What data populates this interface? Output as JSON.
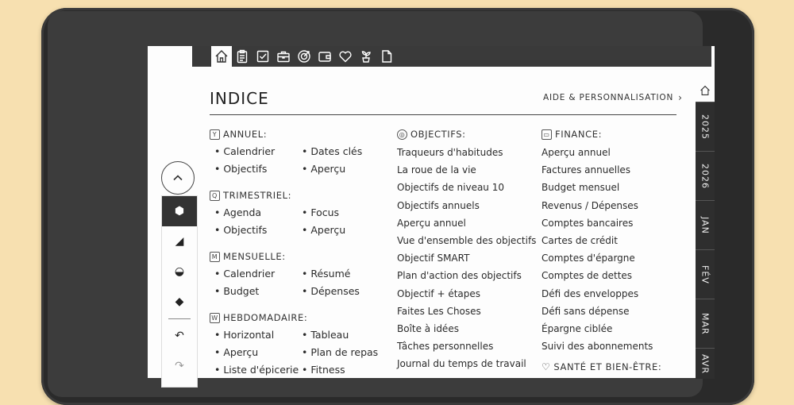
{
  "top_tabs": [
    {
      "icon": "home-icon",
      "active": true
    },
    {
      "icon": "clipboard-icon",
      "active": false
    },
    {
      "icon": "checkbox-icon",
      "active": false
    },
    {
      "icon": "briefcase-icon",
      "active": false
    },
    {
      "icon": "target-icon",
      "active": false
    },
    {
      "icon": "wallet-icon",
      "active": false
    },
    {
      "icon": "heart-icon",
      "active": false
    },
    {
      "icon": "plant-icon",
      "active": false
    },
    {
      "icon": "document-icon",
      "active": false
    }
  ],
  "page": {
    "title": "INDICE",
    "help_link": "AIDE & PERSONNALISATION",
    "help_chevron": "›"
  },
  "sections": {
    "annuel": {
      "badge": "Y",
      "title": "ANNUEL:",
      "items": [
        "• Calendrier",
        "• Dates clés",
        "• Objectifs",
        "• Aperçu"
      ]
    },
    "trimestriel": {
      "badge": "Q",
      "title": "TRIMESTRIEL:",
      "items": [
        "• Agenda",
        "• Focus",
        "• Objectifs",
        "• Aperçu"
      ]
    },
    "mensuelle": {
      "badge": "M",
      "title": "MENSUELLE:",
      "items": [
        "• Calendrier",
        "• Résumé",
        "• Budget",
        "• Dépenses"
      ]
    },
    "hebdomadaire": {
      "badge": "W",
      "title": "HEBDOMADAIRE:",
      "items": [
        "• Horizontal",
        "• Tableau",
        "• Aperçu",
        "• Plan de repas",
        "• Liste d'épicerie",
        "• Fitness"
      ]
    },
    "objectifs": {
      "title": "OBJECTIFS:",
      "items": [
        "Traqueurs d'habitudes",
        "La roue de la vie",
        "Objectifs de niveau 10",
        "Objectifs annuels",
        "Aperçu annuel",
        "Vue d'ensemble des objectifs",
        "Objectif SMART",
        "Plan d'action des objectifs",
        "Objectif + étapes",
        "Faites Les Choses",
        "Boîte à idées",
        "Tâches personnelles",
        "Journal du temps de travail"
      ]
    },
    "finance": {
      "title": "FINANCE:",
      "items": [
        "Aperçu annuel",
        "Factures annuelles",
        "Budget mensuel",
        "Revenus / Dépenses",
        "Comptes bancaires",
        "Cartes de crédit",
        "Comptes d'épargne",
        "Comptes de dettes",
        "Défi des enveloppes",
        "Défi sans dépense",
        "Épargne ciblée",
        "Suivi des abonnements"
      ]
    },
    "sante": {
      "title": "SANTÉ ET BIEN-ÊTRE:"
    }
  },
  "right_tabs": [
    "2025",
    "2026",
    "JAN",
    "FÉV",
    "MAR",
    "AVR"
  ],
  "tools": [
    "⬢",
    "◢",
    "◒",
    "◆",
    "↶",
    "↷"
  ]
}
